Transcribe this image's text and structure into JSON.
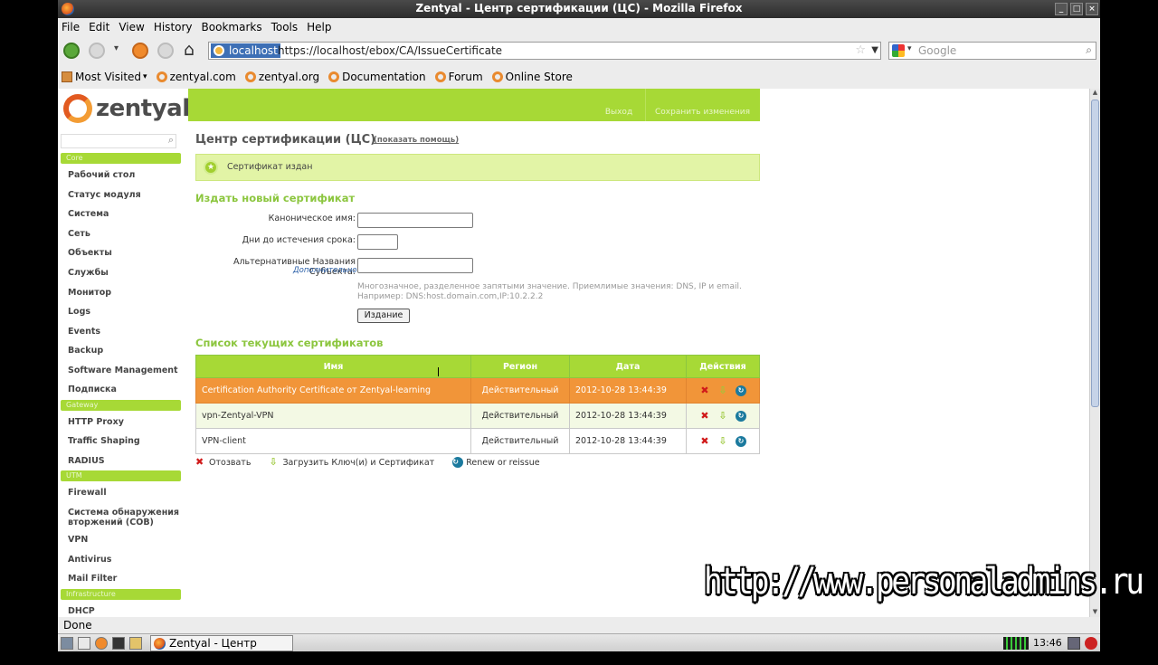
{
  "window": {
    "title": "Zentyal - Центр сертификации (ЦС) - Mozilla Firefox"
  },
  "menu": [
    "File",
    "Edit",
    "View",
    "History",
    "Bookmarks",
    "Tools",
    "Help"
  ],
  "address": {
    "site": "localhost",
    "url": "https://localhost/ebox/CA/IssueCertificate",
    "search_placeholder": "Google"
  },
  "bookmarks": [
    "Most Visited",
    "zentyal.com",
    "zentyal.org",
    "Documentation",
    "Forum",
    "Online Store"
  ],
  "header": {
    "logo": "zentyal",
    "logout": "Выход",
    "save": "Сохранить изменения"
  },
  "sidebar": {
    "cat_core": "Core",
    "core": [
      "Рабочий стол",
      "Статус модуля",
      "Система",
      "Сеть",
      "Объекты",
      "Службы",
      "Монитор",
      "Logs",
      "Events",
      "Backup",
      "Software Management",
      "Подписка"
    ],
    "cat_gateway": "Gateway",
    "gateway": [
      "HTTP Proxy",
      "Traffic Shaping",
      "RADIUS"
    ],
    "cat_utm": "UTM",
    "utm": [
      "Firewall",
      "Система обнаружения вторжений (СОВ)",
      "VPN",
      "Antivirus",
      "Mail Filter"
    ],
    "cat_infra": "Infrastructure",
    "infra": [
      "DHCP"
    ]
  },
  "main": {
    "title": "Центр сертификации (ЦС)",
    "help": "(показать помощь)",
    "notice": "Сертификат издан",
    "issue_title": "Издать новый сертификат",
    "label_cn": "Каноническое имя:",
    "label_days": "Дни до истечения срока:",
    "label_alt": "Альтернативные Названия Субъекта:",
    "more": "Дополнительно",
    "hint1": "Многозначное, разделенное запятыми значение. Приемлимые значения: DNS, IP и email.",
    "hint2": "Например: DNS:host.domain.com,IP:10.2.2.2",
    "issue_btn": "Издание",
    "list_title": "Список текущих сертификатов",
    "columns": [
      "Имя",
      "Регион",
      "Дата",
      "Действия"
    ],
    "rows": [
      {
        "name": "Certification Authority Certificate от Zentyal-learning",
        "state": "Действительный",
        "date": "2012-10-28 13:44:39"
      },
      {
        "name": "vpn-Zentyal-VPN",
        "state": "Действительный",
        "date": "2012-10-28 13:44:39"
      },
      {
        "name": "VPN-client",
        "state": "Действительный",
        "date": "2012-10-28 13:44:39"
      }
    ],
    "legend": {
      "revoke": "Отозвать",
      "download": "Загрузить Ключ(и) и Сертификат",
      "renew": "Renew or reissue"
    }
  },
  "status": "Done",
  "taskbar": {
    "task": "Zentyal - Центр серти...",
    "clock": "13:46"
  },
  "watermark": "http://www.personaladmins.ru"
}
